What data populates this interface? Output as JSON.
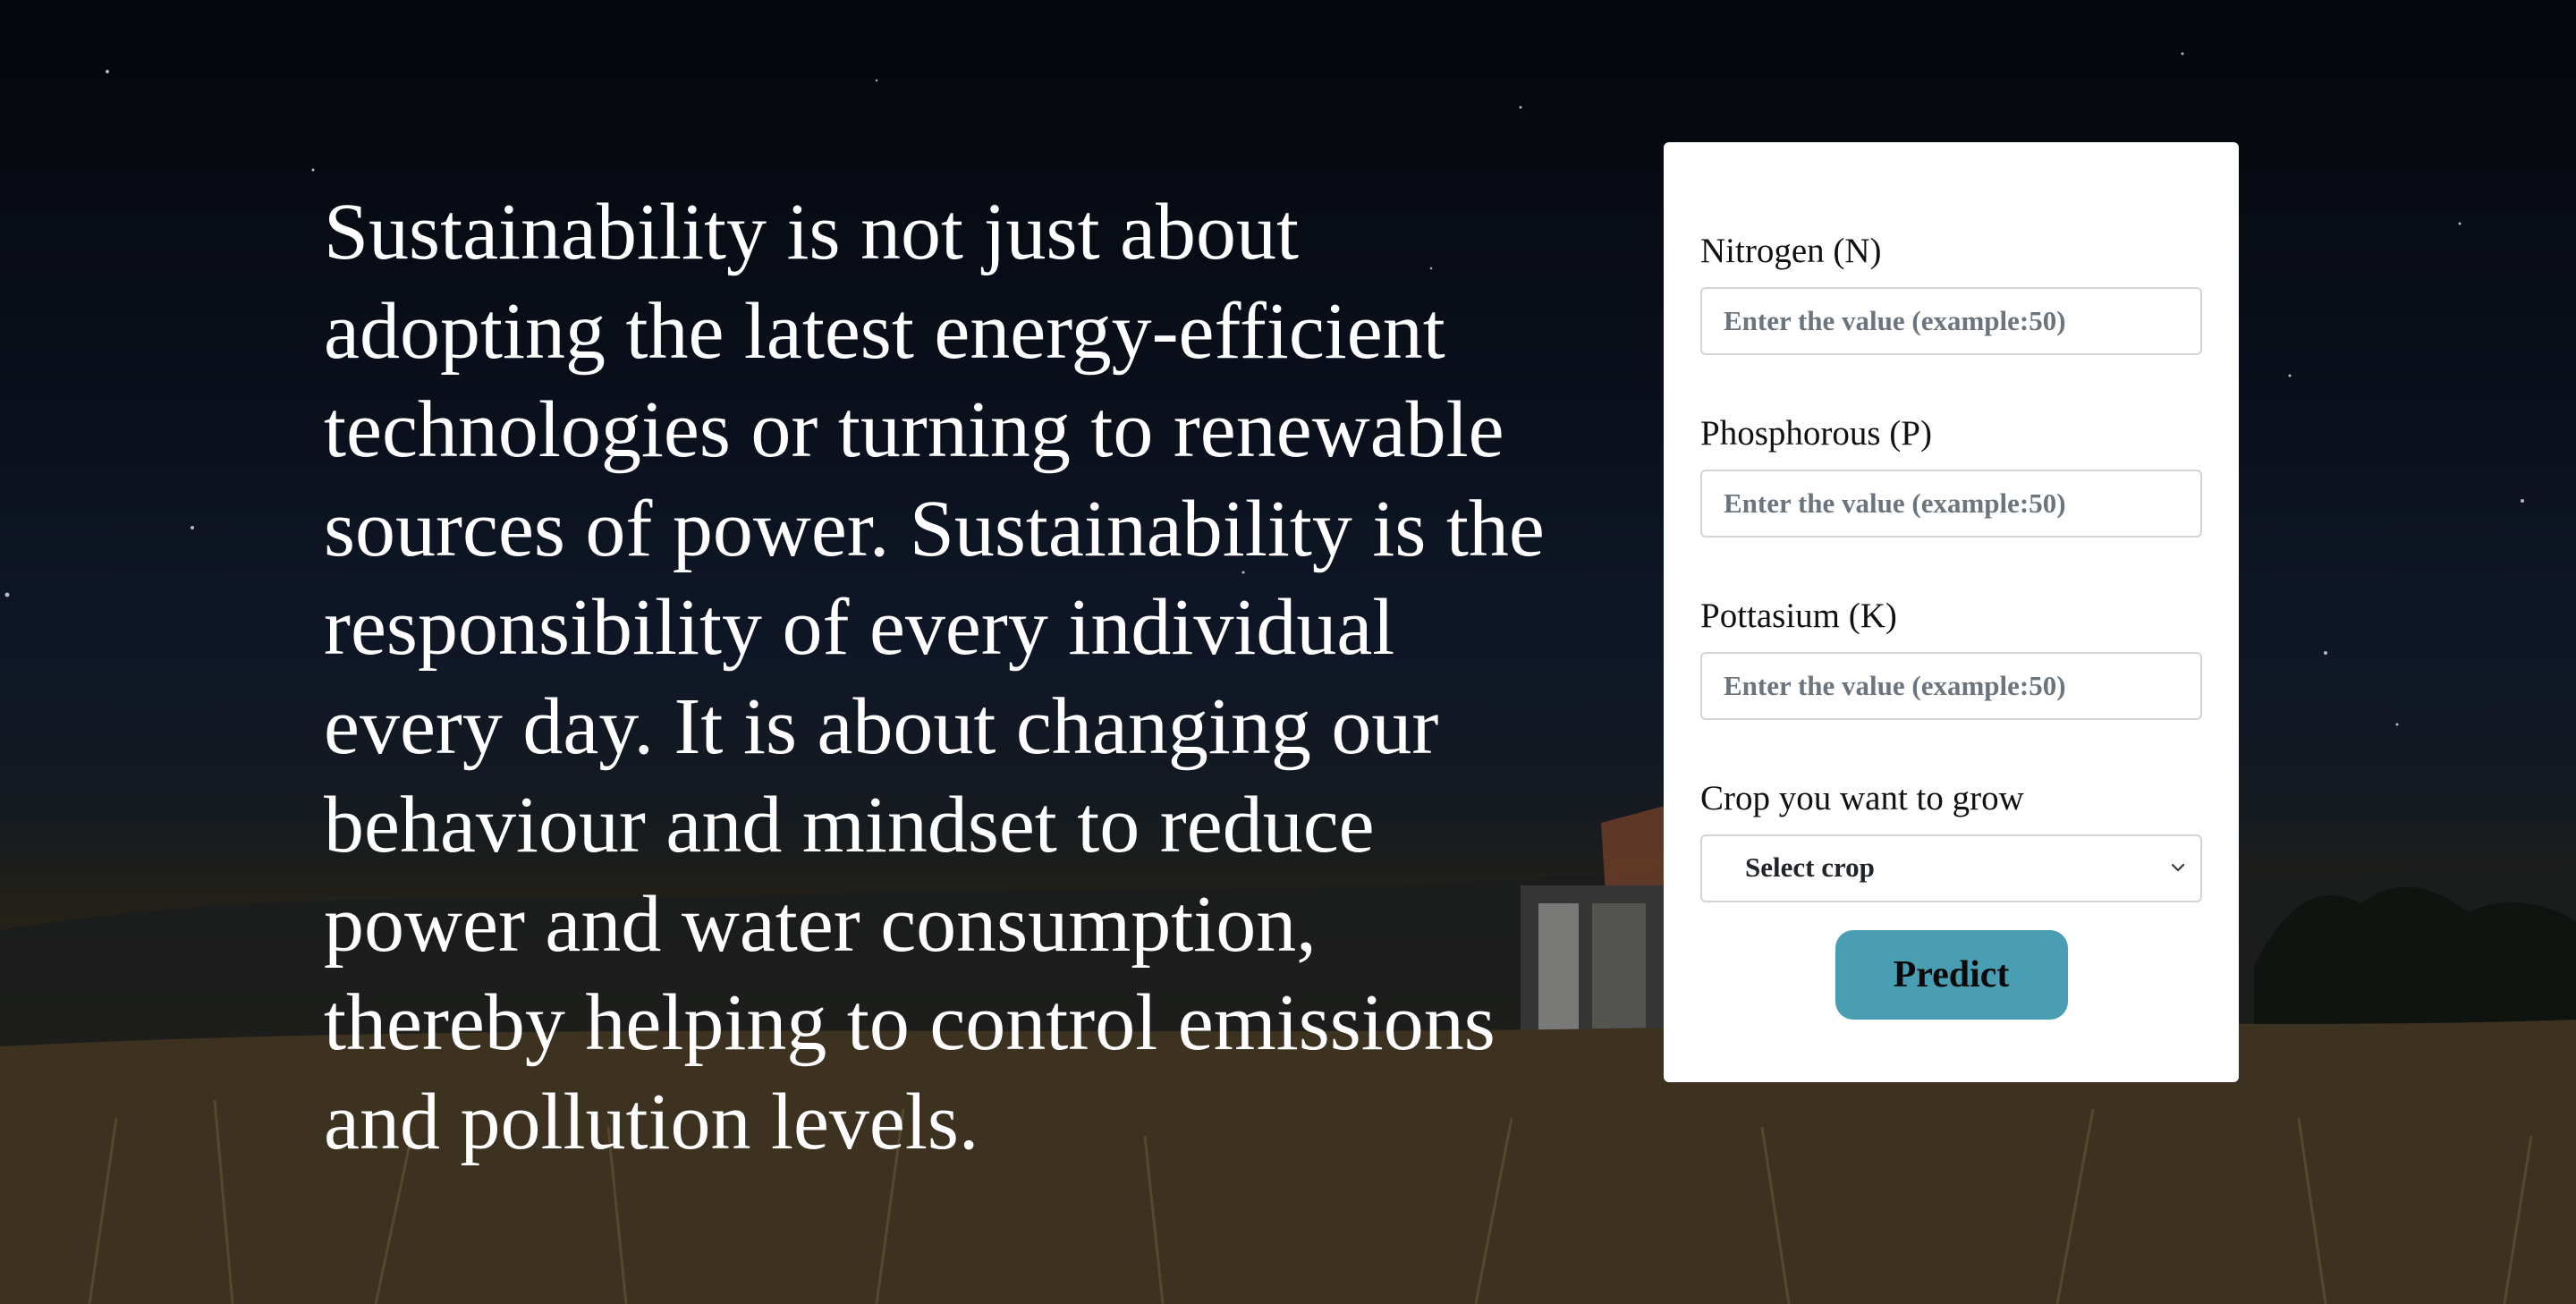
{
  "quote": "Sustainability is not just about adopting the latest energy-efficient technologies or turning to renewable sources of power. Sustainability is the responsibility of every individual every day. It is about changing our behaviour and mindset to reduce power and water consumption, thereby helping to control emissions and pollution levels.",
  "form": {
    "nitrogen": {
      "label": "Nitrogen (N)",
      "placeholder": "Enter the value (example:50)",
      "value": ""
    },
    "phosphorous": {
      "label": "Phosphorous (P)",
      "placeholder": "Enter the value (example:50)",
      "value": ""
    },
    "potassium": {
      "label": "Pottasium (K)",
      "placeholder": "Enter the value (example:50)",
      "value": ""
    },
    "crop": {
      "label": "Crop you want to grow",
      "selected": "Select crop"
    },
    "predict_label": "Predict"
  },
  "colors": {
    "button": "#4a9eb3",
    "card": "#ffffff",
    "text_light": "#ffffff"
  },
  "icons": {
    "select_arrow": "chevron-down-icon"
  }
}
